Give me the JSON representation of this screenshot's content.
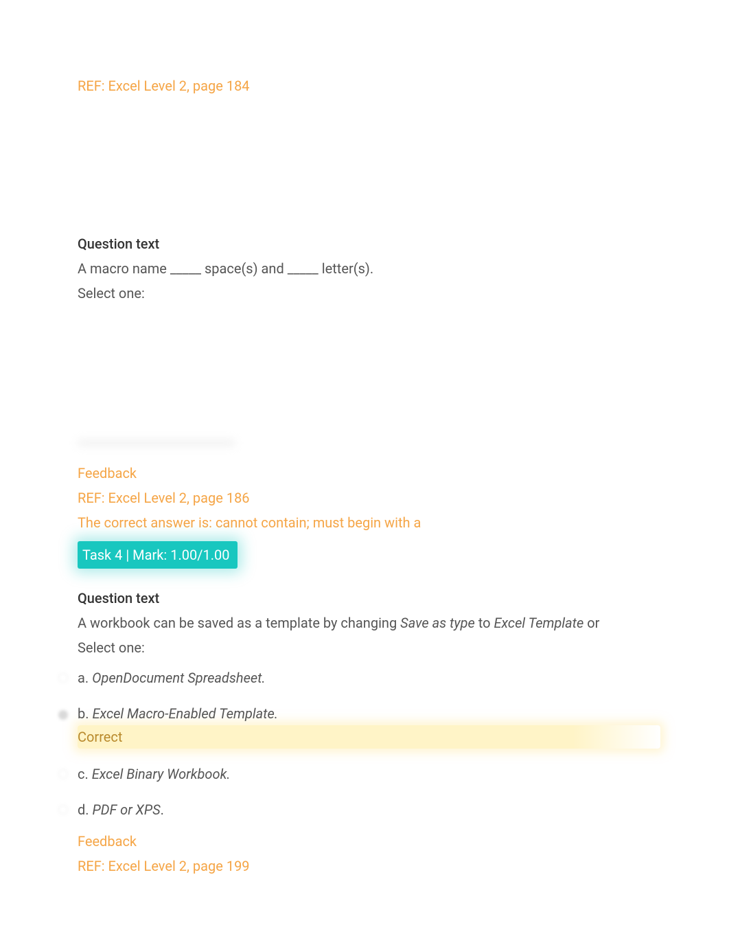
{
  "q_prev": {
    "ref": "REF: Excel Level 2, page 184"
  },
  "q3": {
    "heading": "Question text",
    "prompt": "A macro name _____ space(s) and _____ letter(s).",
    "select_one": "Select one:",
    "feedback_label": "Feedback",
    "ref": "REF: Excel Level 2, page 186",
    "answer_line": "The correct answer is: cannot contain; must begin with a"
  },
  "task4": {
    "label": "Task 4 | Mark: 1.00/1.00"
  },
  "q4": {
    "heading": "Question text",
    "prompt_pre": "A workbook can be saved as a template by changing ",
    "prompt_em1": "Save as type",
    "prompt_mid": " to ",
    "prompt_em2": "Excel Template",
    "prompt_post": " or",
    "select_one": "Select one:",
    "options": [
      {
        "letter": "a.",
        "text_italic": "OpenDocument Spreadsheet.",
        "selected": false,
        "correct": false
      },
      {
        "letter": "b.",
        "text_italic": "Excel Macro-Enabled Template.",
        "selected": true,
        "correct": true
      },
      {
        "letter": "c.",
        "text_italic": "Excel Binary Workbook.",
        "selected": false,
        "correct": false
      },
      {
        "letter": "d.",
        "text_italic": "PDF or XPS",
        "tail": ".",
        "selected": false,
        "correct": false
      }
    ],
    "correct_label": "Correct",
    "feedback_label": "Feedback",
    "ref": "REF: Excel Level 2, page 199"
  },
  "colors": {
    "accent_orange": "#f5a546",
    "accent_teal": "#18c7bf",
    "highlight_yellow": "#fff4c7"
  }
}
